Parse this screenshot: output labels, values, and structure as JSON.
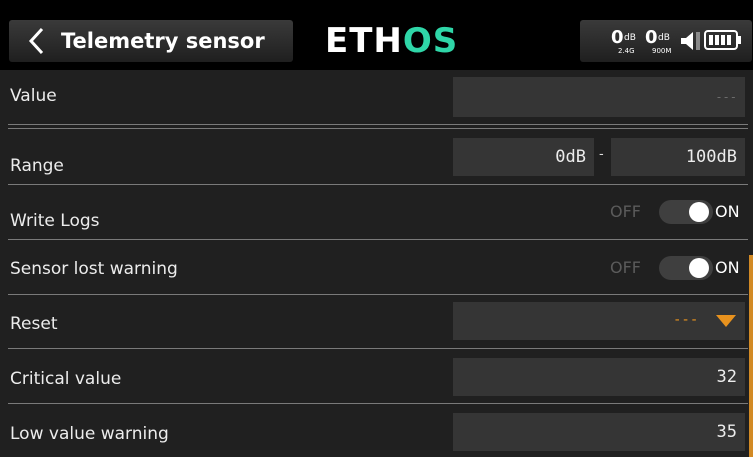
{
  "header": {
    "title": "Telemetry sensor",
    "logo": {
      "main": "ETH",
      "accent": "OS"
    },
    "rssi": [
      {
        "value": "0",
        "unit": "dB",
        "band": "2.4G"
      },
      {
        "value": "0",
        "unit": "dB",
        "band": "900M"
      }
    ],
    "icons": [
      "back-chevron-icon",
      "speaker-icon",
      "battery-icon"
    ]
  },
  "rows": {
    "value": {
      "label": "Value",
      "field": "---"
    },
    "range": {
      "label": "Range",
      "min": "0dB",
      "separator": "-",
      "max": "100dB"
    },
    "write_logs": {
      "label": "Write Logs",
      "off_label": "OFF",
      "on_label": "ON",
      "state": "on"
    },
    "sensor_lost": {
      "label": "Sensor lost warning",
      "off_label": "OFF",
      "on_label": "ON",
      "state": "on"
    },
    "reset": {
      "label": "Reset",
      "selected": "---"
    },
    "critical": {
      "label": "Critical value",
      "field": "32"
    },
    "low_warning": {
      "label": "Low value warning",
      "field": "35"
    }
  },
  "colors": {
    "accent": "#e8921e",
    "logo_accent": "#2fd6a8",
    "background": "#202020",
    "field": "#353535"
  }
}
